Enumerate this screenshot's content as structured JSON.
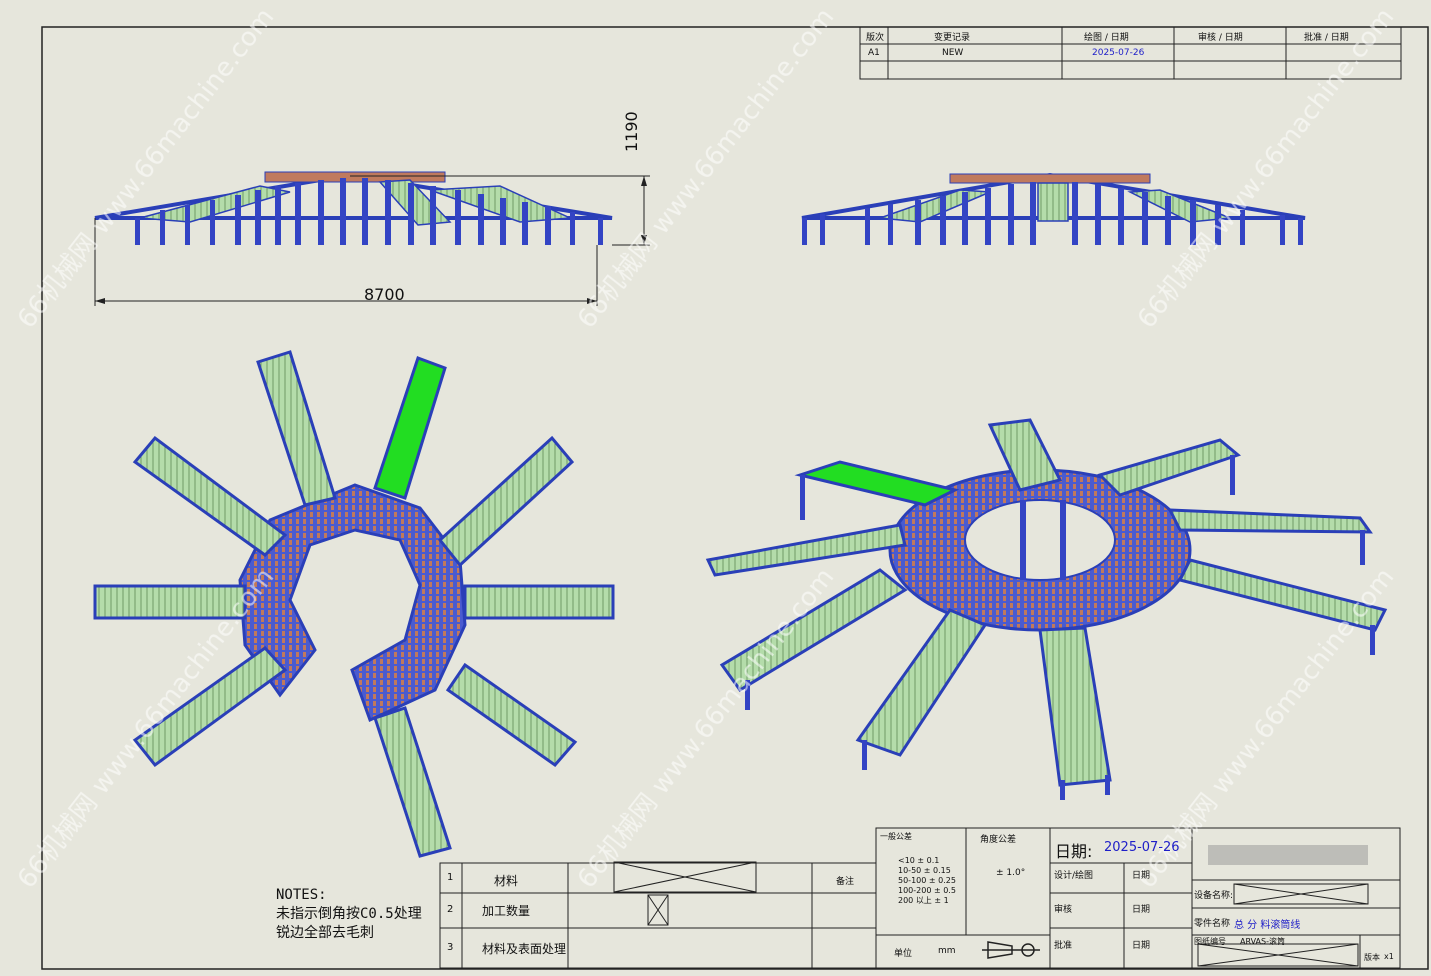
{
  "revision_table": {
    "headers": [
      "版次",
      "变更记录",
      "绘图 / 日期",
      "审核 / 日期",
      "批准 / 日期"
    ],
    "row": {
      "rev": "A1",
      "change": "NEW",
      "date": "2025-07-26"
    }
  },
  "dimensions": {
    "height": "1190",
    "width": "8700"
  },
  "notes": {
    "title": "NOTES:",
    "line1": "未指示倒角按C0.5处理",
    "line2": "锐边全部去毛刺"
  },
  "material_table": {
    "row1": {
      "num": "1",
      "label": "材料"
    },
    "row2": {
      "num": "2",
      "label": "加工数量"
    },
    "row3": {
      "num": "3",
      "label": "材料及表面处理"
    },
    "remark": "备注"
  },
  "tolerance": {
    "title": "一般公差",
    "lines": [
      "<10  ± 0.1",
      "10-50  ± 0.15",
      "50-100  ± 0.25",
      "100-200  ± 0.5",
      "200 以上  ± 1"
    ],
    "angle_title": "角度公差",
    "angle_value": "± 1.0°",
    "unit_label": "单位",
    "unit_value": "mm"
  },
  "title_block": {
    "date_label": "日期:",
    "date_value": "2025-07-26",
    "design": "设计/绘图",
    "date": "日期",
    "review": "审核",
    "approve": "批准",
    "device_name_label": "设备名称:",
    "part_name_label": "零件名称",
    "part_name_value": "总  分  料滚筒线",
    "drawing_no_label": "图纸编号",
    "drawing_no_value": "ARVAS-滚筒",
    "version_label": "版本",
    "version_value": "x1"
  },
  "watermark": "66机械网 www.66machine.com",
  "colors": {
    "frame_blue": "#2a3fb8",
    "roller_green": "#a9d4a0",
    "highlight_green": "#22dd22",
    "ring_blue": "#4455cc"
  }
}
